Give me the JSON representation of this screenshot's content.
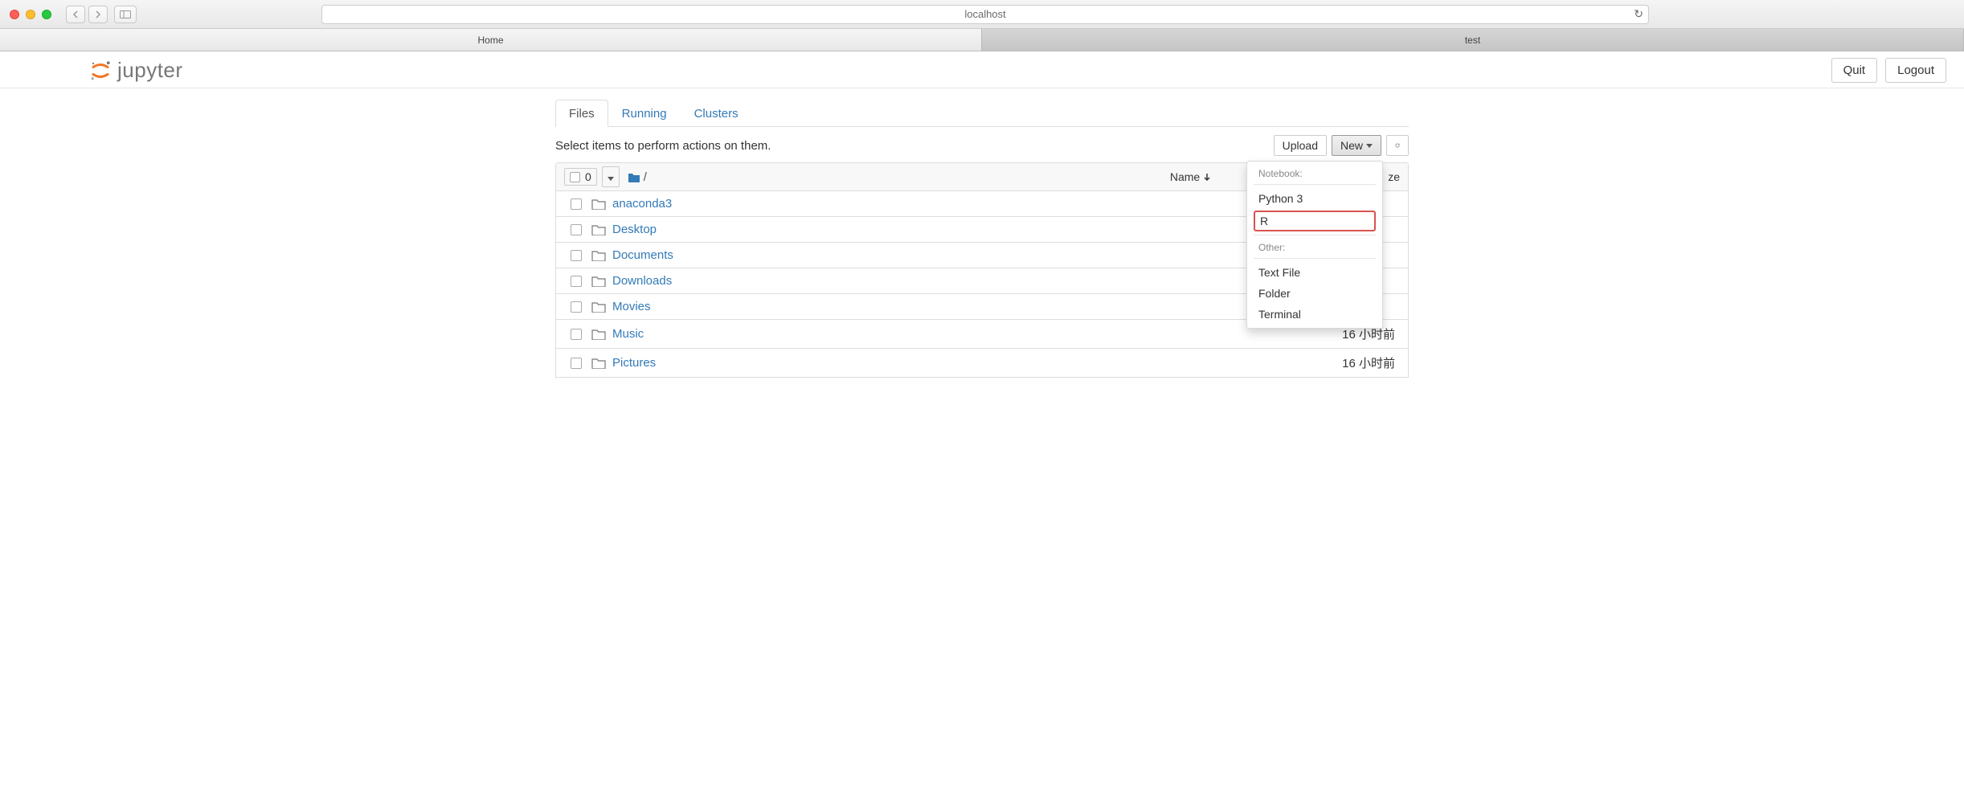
{
  "browser": {
    "url": "localhost",
    "tabs": [
      "Home",
      "test"
    ]
  },
  "header": {
    "logo_text": "jupyter",
    "quit": "Quit",
    "logout": "Logout"
  },
  "tabs": {
    "files": "Files",
    "running": "Running",
    "clusters": "Clusters"
  },
  "actions": {
    "prompt": "Select items to perform actions on them.",
    "upload": "Upload",
    "new": "New",
    "refresh_title": "Refresh notebook list"
  },
  "list_header": {
    "selected_count": "0",
    "breadcrumb": "/",
    "name_col": "Name",
    "size_col_partial": "ze"
  },
  "files": [
    {
      "name": "anaconda3",
      "modified": ""
    },
    {
      "name": "Desktop",
      "modified": ""
    },
    {
      "name": "Documents",
      "modified": ""
    },
    {
      "name": "Downloads",
      "modified": ""
    },
    {
      "name": "Movies",
      "modified": ""
    },
    {
      "name": "Music",
      "modified": "16 小时前"
    },
    {
      "name": "Pictures",
      "modified": "16 小时前"
    }
  ],
  "dropdown": {
    "notebook_header": "Notebook:",
    "python3": "Python 3",
    "r": "R",
    "other_header": "Other:",
    "textfile": "Text File",
    "folder": "Folder",
    "terminal": "Terminal"
  }
}
